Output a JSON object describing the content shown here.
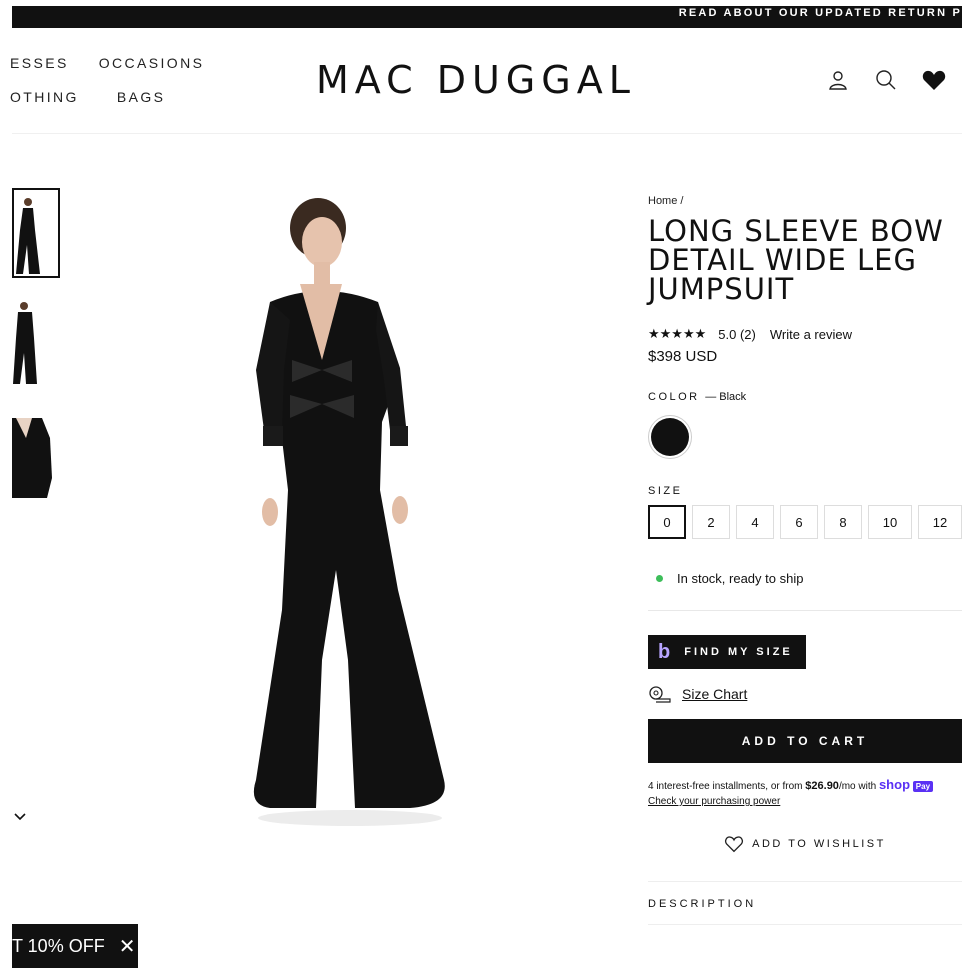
{
  "announcement": "READ ABOUT OUR UPDATED RETURN P",
  "nav": {
    "row1": [
      "ESSES",
      "OCCASIONS"
    ],
    "row2": [
      "OTHING",
      "BAGS"
    ]
  },
  "logo": "MAC DUGGAL",
  "header_icons": [
    "account-icon",
    "search-icon",
    "heart-icon"
  ],
  "promo": {
    "text": "T 10% OFF",
    "close": "✕"
  },
  "product": {
    "breadcrumb": "Home /",
    "title": "LONG SLEEVE BOW DETAIL WIDE LEG JUMPSUIT",
    "stars": "★★★★★",
    "rating": "5.0 (2)",
    "write_review": "Write a review",
    "price": "$398 USD",
    "color_label": "COLOR",
    "color_value": "— Black",
    "size_label": "SIZE",
    "sizes": [
      "0",
      "2",
      "4",
      "6",
      "8",
      "10",
      "12"
    ],
    "selected_size": "0",
    "stock": "In stock, ready to ship",
    "find_size": "FIND MY SIZE",
    "size_chart": "Size Chart",
    "add_to_cart": "ADD TO CART",
    "installments_pre": "4 interest-free installments, or from",
    "installments_amount": "$26.90",
    "installments_post": "/mo with",
    "shop": "shop",
    "shop_pay": "Pay",
    "purchasing_power": "Check your purchasing power",
    "wishlist": "ADD TO WISHLIST",
    "description": "DESCRIPTION"
  },
  "colors": {
    "brand": "#111111",
    "stock": "#3dbe5a",
    "shop": "#5a31f4"
  }
}
